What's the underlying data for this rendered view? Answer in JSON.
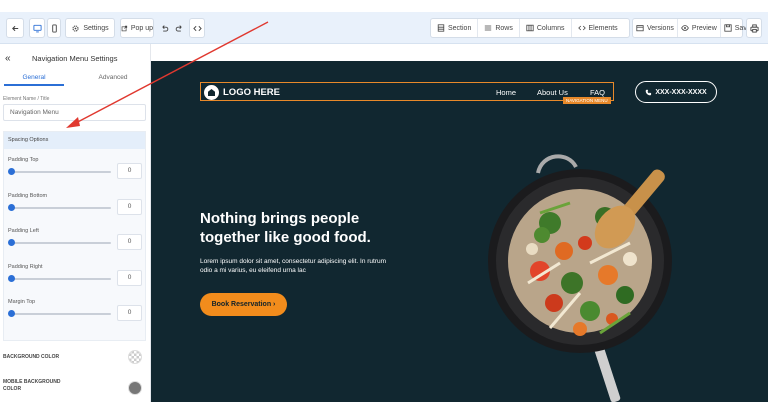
{
  "toolbar": {
    "settings_label": "Settings",
    "popup_label": "Pop up",
    "section_label": "Section",
    "rows_label": "Rows",
    "columns_label": "Columns",
    "elements_label": "Elements",
    "versions_label": "Versions",
    "preview_label": "Preview",
    "save_label": "Save"
  },
  "sidebar": {
    "back_icon": "«",
    "title": "Navigation Menu Settings",
    "tabs": [
      {
        "label": "General"
      },
      {
        "label": "Advanced"
      }
    ],
    "element_name_label": "Element Name / Title",
    "element_name_value": "Navigation Menu",
    "spacing_title": "Spacing Options",
    "sliders": [
      {
        "label": "Padding Top",
        "value": "0"
      },
      {
        "label": "Padding Bottom",
        "value": "0"
      },
      {
        "label": "Padding Left",
        "value": "0"
      },
      {
        "label": "Padding Right",
        "value": "0"
      },
      {
        "label": "Margin Top",
        "value": "0"
      }
    ],
    "bg_color_label": "BACKGROUND COLOR",
    "mobile_bg_label": "MOBILE BACKGROUND",
    "mobile_bg_label_2": "COLOR"
  },
  "page": {
    "logo_text": "LOGO HERE",
    "nav_links": [
      {
        "label": "Home"
      },
      {
        "label": "About Us"
      },
      {
        "label": "FAQ"
      }
    ],
    "nav_tag": "NAVIGATION MENU",
    "phone": "XXX-XXX-XXXX",
    "hero_title": "Nothing brings people together like good food.",
    "hero_text": "Lorem ipsum dolor sit amet, consectetur adipiscing elit. In rutrum odio a mi varius, eu eleifend urna lac",
    "cta_label": "Book Reservation ›"
  },
  "colors": {
    "accent": "#2b6fd6",
    "canvas_bg": "#112730",
    "orange": "#f28c1c",
    "annotation_arrow": "#e0382f"
  }
}
